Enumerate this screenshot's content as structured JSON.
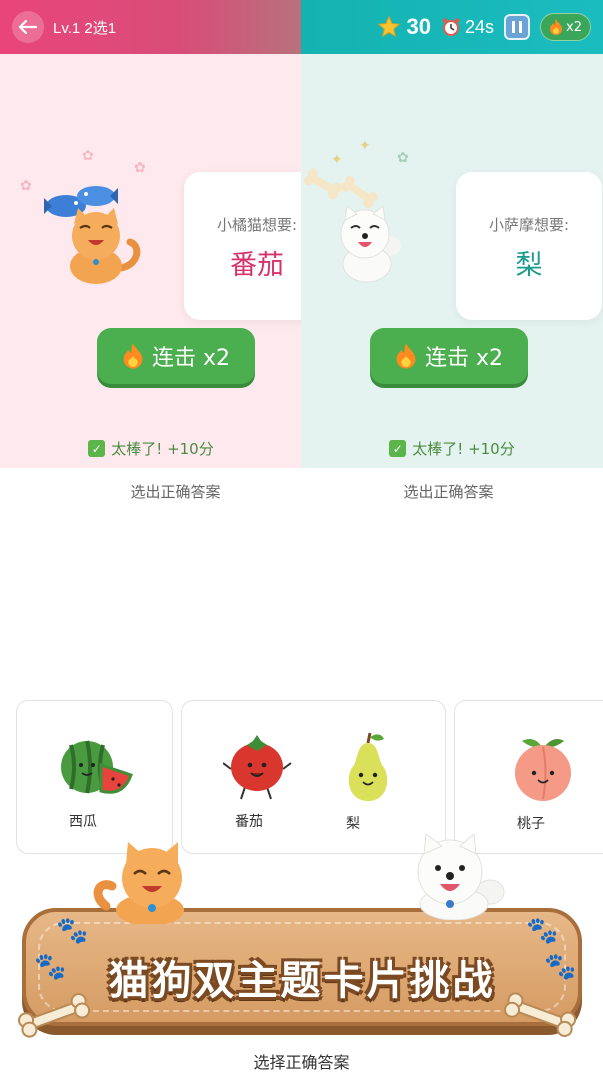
{
  "header": {
    "level": "Lv.1 2选1",
    "score": "30",
    "timer": "24s",
    "combo": "x2",
    "colors": {
      "left": "#e9457a",
      "right": "#14b3b1"
    }
  },
  "left_panel": {
    "want_label": "小橘猫想要:",
    "want_item": "番茄",
    "item_color": "#d6336c",
    "combo_label": "连击 x2",
    "feedback": "太棒了! +10分",
    "prompt": "选出正确答案"
  },
  "right_panel": {
    "want_label": "小萨摩想要:",
    "want_item": "梨",
    "item_color": "#1b9c8c",
    "combo_label": "连击 x2",
    "feedback": "太棒了! +10分",
    "prompt": "选出正确答案"
  },
  "options": [
    {
      "label": "西瓜",
      "icon": "watermelon-icon"
    },
    {
      "label": "番茄",
      "icon": "tomato-icon"
    },
    {
      "label": "梨",
      "icon": "pear-icon"
    },
    {
      "label": "桃子",
      "icon": "peach-icon"
    }
  ],
  "banner": {
    "title": "猫狗双主题卡片挑战"
  },
  "bottom_prompt": "选择正确答案"
}
